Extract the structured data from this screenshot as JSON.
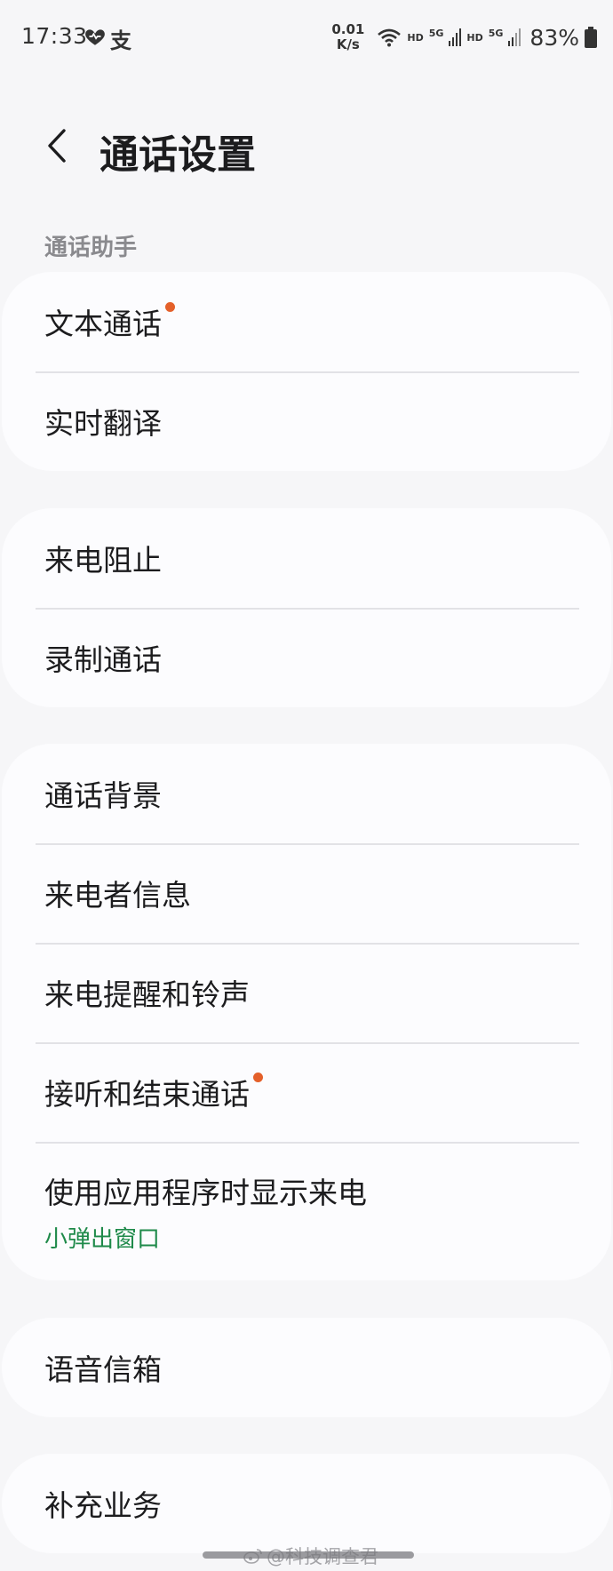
{
  "status_bar": {
    "time": "17:33",
    "speed_value": "0.01",
    "speed_unit": "K/s",
    "hd1": "HD",
    "sig1": "5G",
    "hd2": "HD",
    "sig2": "5G",
    "battery": "83%",
    "alipay_glyph": "支"
  },
  "header": {
    "title": "通话设置"
  },
  "sections": {
    "assistant_label": "通话助手"
  },
  "cards": [
    {
      "items": [
        {
          "label": "文本通话",
          "dot": true
        },
        {
          "label": "实时翻译"
        }
      ]
    },
    {
      "items": [
        {
          "label": "来电阻止"
        },
        {
          "label": "录制通话"
        }
      ]
    },
    {
      "items": [
        {
          "label": "通话背景"
        },
        {
          "label": "来电者信息"
        },
        {
          "label": "来电提醒和铃声"
        },
        {
          "label": "接听和结束通话",
          "dot": true
        },
        {
          "label": "使用应用程序时显示来电",
          "sub": "小弹出窗口"
        }
      ]
    },
    {
      "items": [
        {
          "label": "语音信箱"
        }
      ]
    },
    {
      "items": [
        {
          "label": "补充业务"
        }
      ]
    }
  ],
  "watermark": "@科技调查君",
  "colors": {
    "background": "#f6f6f8",
    "card": "#fcfcfe",
    "badge_dot": "#e4602a",
    "subtitle_green": "#1f8a4a"
  }
}
